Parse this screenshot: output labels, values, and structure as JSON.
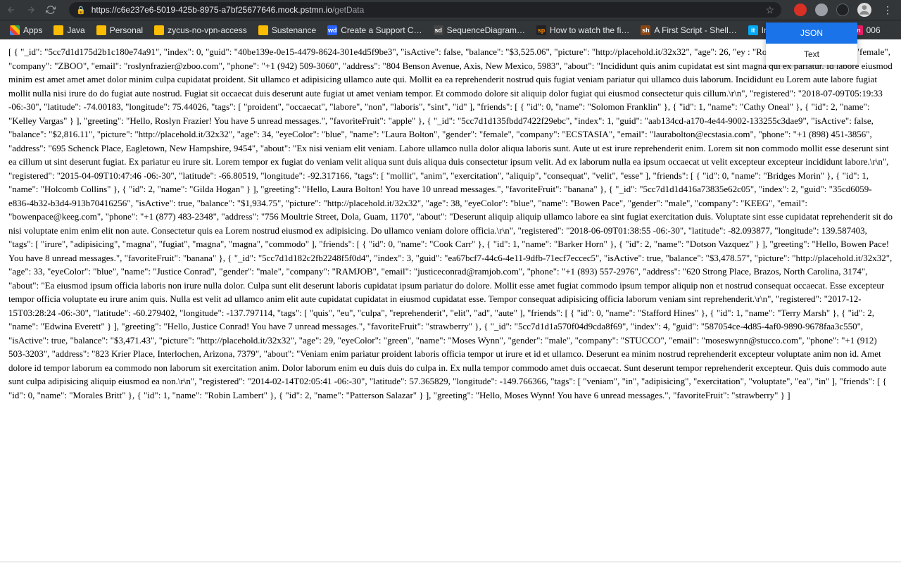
{
  "url": {
    "host": "https://c6e237e6-5019-425b-8975-a7bf25677646.mock.pstmn.io",
    "path": "/getData"
  },
  "bookmarks": [
    {
      "label": "Apps",
      "icon": "apps"
    },
    {
      "label": "Java",
      "icon": "folder"
    },
    {
      "label": "Personal",
      "icon": "folder"
    },
    {
      "label": "zycus-no-vpn-access",
      "icon": "folder"
    },
    {
      "label": "Sustenance",
      "icon": "folder"
    },
    {
      "label": "Create a Support C…",
      "icon": "wd",
      "bg": "#2962ff",
      "fg": "#fff"
    },
    {
      "label": "SequenceDiagram…",
      "icon": "sd",
      "bg": "#444",
      "fg": "#fff"
    },
    {
      "label": "How to watch the fi…",
      "icon": "sp",
      "bg": "#222",
      "fg": "#f80"
    },
    {
      "label": "A First Script - Shell…",
      "icon": "sh",
      "bg": "#8b4513",
      "fg": "#fff"
    },
    {
      "label": "Information Techno…",
      "icon": "it",
      "bg": "#03a9f4",
      "fg": "#fff"
    },
    {
      "label": "006",
      "icon": "in",
      "bg": "#e91e63",
      "fg": "#fff"
    }
  ],
  "dropdown": {
    "json": "JSON",
    "text": "Text"
  },
  "body_text": "[ { \"_id\": \"5cc7d1d175d2b1c180e74a91\", \"index\": 0, \"guid\": \"40be139e-0e15-4479-8624-301e4d5f9be3\", \"isActive\": false, \"balance\": \"$3,525.06\", \"picture\": \"http://placehold.it/32x32\", \"age\": 26, \"ey                                   : \"Roslyn Frazier\", \"gender\": \"female\", \"company\": \"ZBOO\", \"email\": \"roslynfrazier@zboo.com\", \"phone\": \"+1 (942) 509-3060\", \"address\": \"804 Benson Avenue, Axis, New Mexico, 5983\", \"about\": \"Incididunt quis anim cupidatat est sint magna qui ex pariatur. Id labore eiusmod minim est amet amet amet dolor minim culpa cupidatat proident. Sit ullamco et adipisicing ullamco aute qui. Mollit ea ea reprehenderit nostrud quis fugiat veniam pariatur qui ullamco duis laborum. Incididunt eu Lorem aute labore fugiat mollit nulla nisi irure do do fugiat aute nostrud. Fugiat sit occaecat duis deserunt aute fugiat ut amet veniam tempor. Et commodo dolore sit aliquip dolor fugiat qui eiusmod consectetur quis cillum.\\r\\n\", \"registered\": \"2018-07-09T05:19:33 -06:-30\", \"latitude\": -74.00183, \"longitude\": 75.44026, \"tags\": [ \"proident\", \"occaecat\", \"labore\", \"non\", \"laboris\", \"sint\", \"id\" ], \"friends\": [ { \"id\": 0, \"name\": \"Solomon Franklin\" }, { \"id\": 1, \"name\": \"Cathy Oneal\" }, { \"id\": 2, \"name\": \"Kelley Vargas\" } ], \"greeting\": \"Hello, Roslyn Frazier! You have 5 unread messages.\", \"favoriteFruit\": \"apple\" }, { \"_id\": \"5cc7d1d135fbdd7422f29ebc\", \"index\": 1, \"guid\": \"aab134cd-a170-4e44-9002-133255c3dae9\", \"isActive\": false, \"balance\": \"$2,816.11\", \"picture\": \"http://placehold.it/32x32\", \"age\": 34, \"eyeColor\": \"blue\", \"name\": \"Laura Bolton\", \"gender\": \"female\", \"company\": \"ECSTASIA\", \"email\": \"laurabolton@ecstasia.com\", \"phone\": \"+1 (898) 451-3856\", \"address\": \"695 Schenck Place, Eagletown, New Hampshire, 9454\", \"about\": \"Ex nisi veniam elit veniam. Labore ullamco nulla dolor aliqua laboris sunt. Aute ut est irure reprehenderit enim. Lorem sit non commodo mollit esse deserunt sint ea cillum ut sint deserunt fugiat. Ex pariatur eu irure sit. Lorem tempor ex fugiat do veniam velit aliqua sunt duis aliqua duis consectetur ipsum velit. Ad ex laborum nulla ea ipsum occaecat ut velit excepteur excepteur incididunt labore.\\r\\n\", \"registered\": \"2015-04-09T10:47:46 -06:-30\", \"latitude\": -66.80519, \"longitude\": -92.317166, \"tags\": [ \"mollit\", \"anim\", \"exercitation\", \"aliquip\", \"consequat\", \"velit\", \"esse\" ], \"friends\": [ { \"id\": 0, \"name\": \"Bridges Morin\" }, { \"id\": 1, \"name\": \"Holcomb Collins\" }, { \"id\": 2, \"name\": \"Gilda Hogan\" } ], \"greeting\": \"Hello, Laura Bolton! You have 10 unread messages.\", \"favoriteFruit\": \"banana\" }, { \"_id\": \"5cc7d1d1d416a73835e62c05\", \"index\": 2, \"guid\": \"35cd6059-e836-4b32-b3d4-913b70416256\", \"isActive\": true, \"balance\": \"$1,934.75\", \"picture\": \"http://placehold.it/32x32\", \"age\": 38, \"eyeColor\": \"blue\", \"name\": \"Bowen Pace\", \"gender\": \"male\", \"company\": \"KEEG\", \"email\": \"bowenpace@keeg.com\", \"phone\": \"+1 (877) 483-2348\", \"address\": \"756 Moultrie Street, Dola, Guam, 1170\", \"about\": \"Deserunt aliquip aliquip ullamco labore ea sint fugiat exercitation duis. Voluptate sint esse cupidatat reprehenderit sit do nisi voluptate enim enim elit non aute. Consectetur quis ea Lorem nostrud eiusmod ex adipisicing. Do ullamco veniam dolore officia.\\r\\n\", \"registered\": \"2018-06-09T01:38:55 -06:-30\", \"latitude\": -82.093877, \"longitude\": 139.587403, \"tags\": [ \"irure\", \"adipisicing\", \"magna\", \"fugiat\", \"magna\", \"magna\", \"commodo\" ], \"friends\": [ { \"id\": 0, \"name\": \"Cook Carr\" }, { \"id\": 1, \"name\": \"Barker Horn\" }, { \"id\": 2, \"name\": \"Dotson Vazquez\" } ], \"greeting\": \"Hello, Bowen Pace! You have 8 unread messages.\", \"favoriteFruit\": \"banana\" }, { \"_id\": \"5cc7d1d182c2fb2248f5f0d4\", \"index\": 3, \"guid\": \"ea67bcf7-44c6-4e11-9dfb-71ecf7eccec5\", \"isActive\": true, \"balance\": \"$3,478.57\", \"picture\": \"http://placehold.it/32x32\", \"age\": 33, \"eyeColor\": \"blue\", \"name\": \"Justice Conrad\", \"gender\": \"male\", \"company\": \"RAMJOB\", \"email\": \"justiceconrad@ramjob.com\", \"phone\": \"+1 (893) 557-2976\", \"address\": \"620 Strong Place, Brazos, North Carolina, 3174\", \"about\": \"Ea eiusmod ipsum officia laboris non irure nulla dolor. Culpa sunt elit deserunt laboris cupidatat ipsum pariatur do dolore. Mollit esse amet fugiat commodo ipsum tempor aliquip non et nostrud consequat occaecat. Esse excepteur tempor officia voluptate eu irure anim quis. Nulla est velit ad ullamco anim elit aute cupidatat cupidatat in eiusmod cupidatat esse. Tempor consequat adipisicing officia laborum veniam sint reprehenderit.\\r\\n\", \"registered\": \"2017-12-15T03:28:24 -06:-30\", \"latitude\": -60.279402, \"longitude\": -137.797114, \"tags\": [ \"quis\", \"eu\", \"culpa\", \"reprehenderit\", \"elit\", \"ad\", \"aute\" ], \"friends\": [ { \"id\": 0, \"name\": \"Stafford Hines\" }, { \"id\": 1, \"name\": \"Terry Marsh\" }, { \"id\": 2, \"name\": \"Edwina Everett\" } ], \"greeting\": \"Hello, Justice Conrad! You have 7 unread messages.\", \"favoriteFruit\": \"strawberry\" }, { \"_id\": \"5cc7d1d1a570f04d9cda8f69\", \"index\": 4, \"guid\": \"587054ce-4d85-4af0-9890-9678faa3c550\", \"isActive\": true, \"balance\": \"$3,471.43\", \"picture\": \"http://placehold.it/32x32\", \"age\": 29, \"eyeColor\": \"green\", \"name\": \"Moses Wynn\", \"gender\": \"male\", \"company\": \"STUCCO\", \"email\": \"moseswynn@stucco.com\", \"phone\": \"+1 (912) 503-3203\", \"address\": \"823 Krier Place, Interlochen, Arizona, 7379\", \"about\": \"Veniam enim pariatur proident laboris officia tempor ut irure et id et ullamco. Deserunt ea minim nostrud reprehenderit excepteur voluptate anim non id. Amet dolore id tempor laborum ea commodo non laborum sit exercitation anim. Dolor laborum enim eu duis duis do culpa in. Ex nulla tempor commodo amet duis occaecat. Sunt deserunt tempor reprehenderit excepteur. Quis duis commodo aute sunt culpa adipisicing aliquip eiusmod ea non.\\r\\n\", \"registered\": \"2014-02-14T02:05:41 -06:-30\", \"latitude\": 57.365829, \"longitude\": -149.766366, \"tags\": [ \"veniam\", \"in\", \"adipisicing\", \"exercitation\", \"voluptate\", \"ea\", \"in\" ], \"friends\": [ { \"id\": 0, \"name\": \"Morales Britt\" }, { \"id\": 1, \"name\": \"Robin Lambert\" }, { \"id\": 2, \"name\": \"Patterson Salazar\" } ], \"greeting\": \"Hello, Moses Wynn! You have 6 unread messages.\", \"favoriteFruit\": \"strawberry\" } ]"
}
